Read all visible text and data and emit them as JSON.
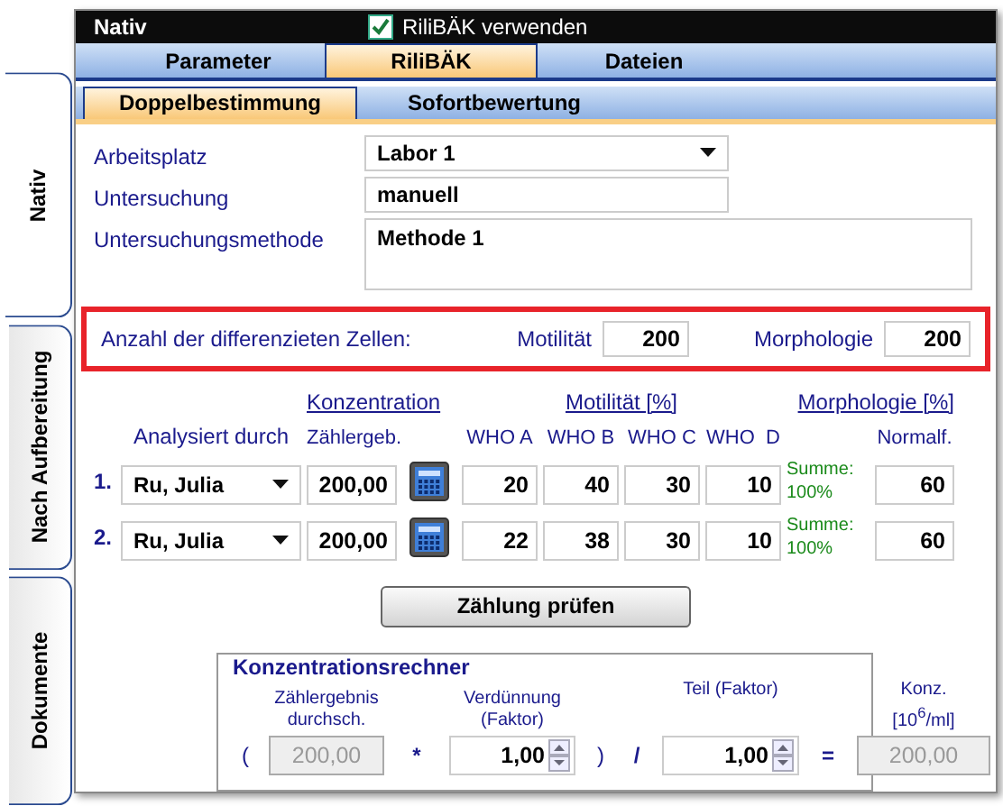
{
  "side_tabs": [
    {
      "label": "Nativ",
      "selected": true
    },
    {
      "label": "Nach Aufbereitung",
      "selected": false
    },
    {
      "label": "Dokumente",
      "selected": false
    }
  ],
  "header": {
    "title": "Nativ",
    "checkbox": {
      "label": "RiliBÄK verwenden",
      "checked": true
    }
  },
  "tabs": [
    {
      "label": "Parameter",
      "selected": false
    },
    {
      "label": "RiliBÄK",
      "selected": true
    },
    {
      "label": "Dateien",
      "selected": false
    }
  ],
  "subtabs": [
    {
      "label": "Doppelbestimmung",
      "selected": true
    },
    {
      "label": "Sofortbewertung",
      "selected": false
    }
  ],
  "fields": [
    {
      "label": "Arbeitsplatz",
      "kind": "dropdown",
      "value": "Labor 1"
    },
    {
      "label": "Untersuchung",
      "kind": "text",
      "value": "manuell"
    },
    {
      "label": "Untersuchungsmethode",
      "kind": "textarea",
      "value": "Methode 1"
    }
  ],
  "cell_count": {
    "label": "Anzahl der differenzieten Zellen:",
    "highlighted": true,
    "motility_label": "Motilität",
    "motility": "200",
    "morphology_label": "Morphologie",
    "morphology": "200"
  },
  "analysis": {
    "group_headers": [
      "Konzentration",
      "Motilität [%]",
      "Morphologie [%]"
    ],
    "columns": [
      "Analysiert durch",
      "Zählergeb.",
      "WHO A",
      "WHO B",
      "WHO C",
      "WHO  D",
      "Normalf."
    ],
    "rows": [
      {
        "index": "1.",
        "analyst": "Ru, Julia",
        "count": "200,00",
        "who": [
          "20",
          "40",
          "30",
          "10"
        ],
        "sum_label": "Summe:",
        "sum": "100%",
        "normal": "60"
      },
      {
        "index": "2.",
        "analyst": "Ru, Julia",
        "count": "200,00",
        "who": [
          "22",
          "38",
          "30",
          "10"
        ],
        "sum_label": "Summe:",
        "sum": "100%",
        "normal": "60"
      }
    ]
  },
  "check_button": "Zählung prüfen",
  "calculator": {
    "title": "Konzentrationsrechner",
    "labels": [
      "Zählergebnis durchsch.",
      "Verdünnung (Faktor)",
      "Teil (Faktor)",
      "Konz. [10$^{6}$/ml]"
    ],
    "open": "(",
    "count": "200,00",
    "times": "*",
    "dilution": "1,00",
    "close": ")",
    "divide": "/",
    "part": "1,00",
    "equals": "=",
    "result": "200,00"
  }
}
